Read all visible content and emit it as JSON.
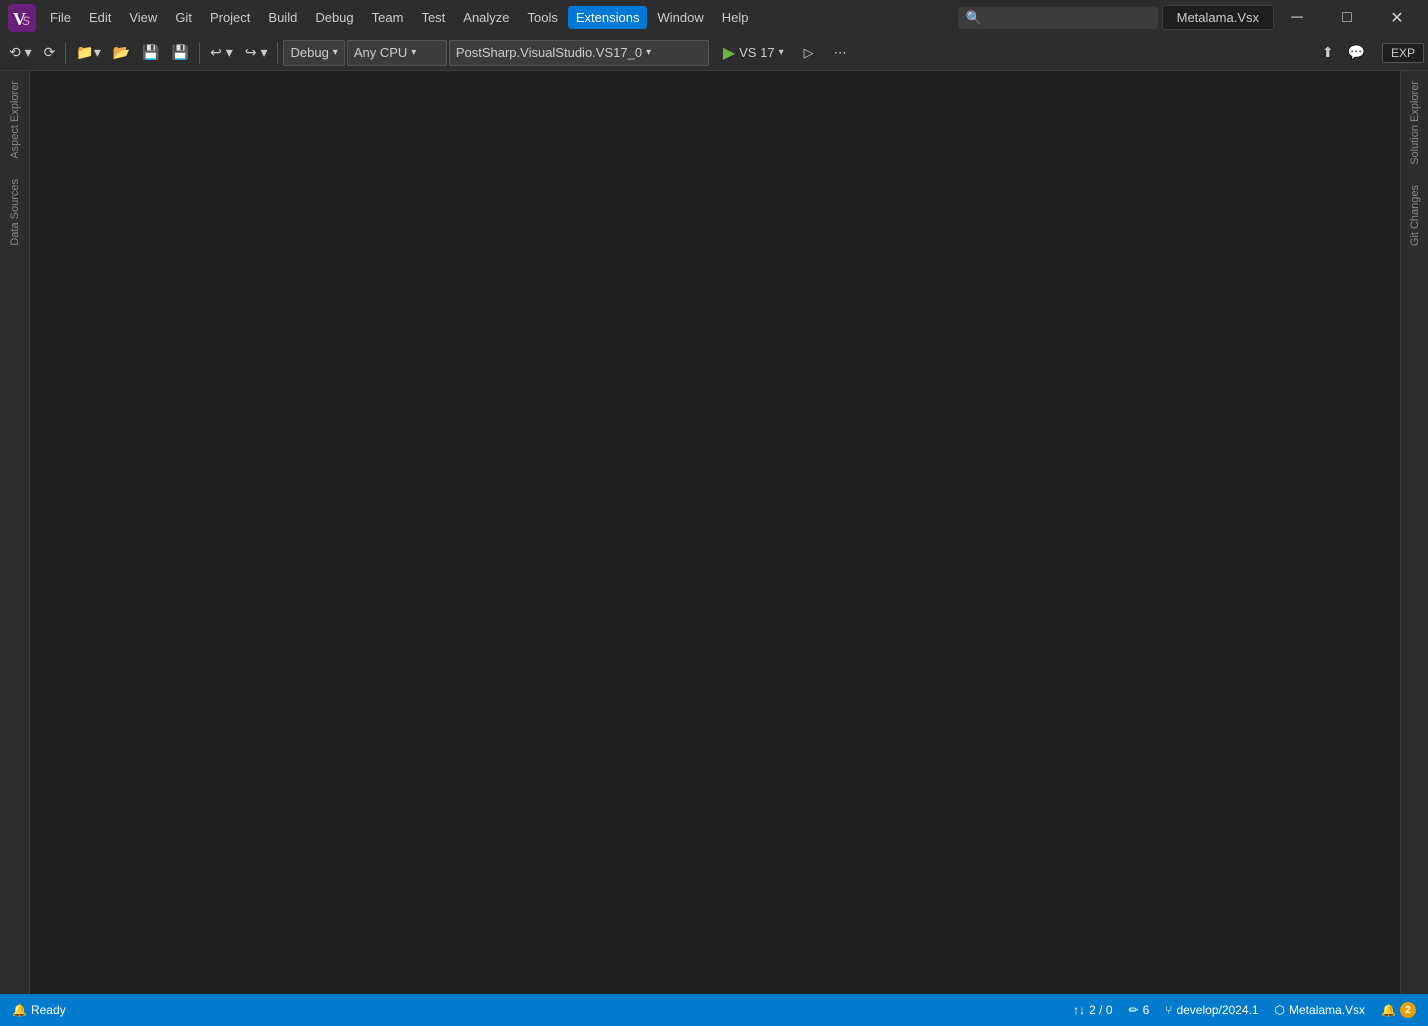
{
  "titleBar": {
    "tabTitle": "Metalama.Vsx",
    "menuItems": [
      "File",
      "Edit",
      "View",
      "Git",
      "Project",
      "Build",
      "Debug",
      "Team",
      "Test",
      "Analyze",
      "Tools",
      "Extensions",
      "Window",
      "Help"
    ],
    "activeMenu": "Extensions",
    "windowControls": {
      "minimize": "─",
      "maximize": "□",
      "close": "✕"
    }
  },
  "toolbar": {
    "debugConfig": "Debug",
    "platform": "Any CPU",
    "startupProject": "PostSharp.VisualStudio.VS17_0",
    "vsVersion": "VS 17",
    "expLabel": "EXP"
  },
  "leftPanel": {
    "labels": [
      "Aspect Explorer",
      "Data Sources"
    ]
  },
  "rightPanel": {
    "labels": [
      "Solution Explorer",
      "Git Changes"
    ]
  },
  "statusBar": {
    "ready": "Ready",
    "errors": "2 / 0",
    "pencil": "6",
    "branch": "develop/2024.1",
    "solution": "Metalama.Vsx",
    "notifBadge": "2"
  }
}
